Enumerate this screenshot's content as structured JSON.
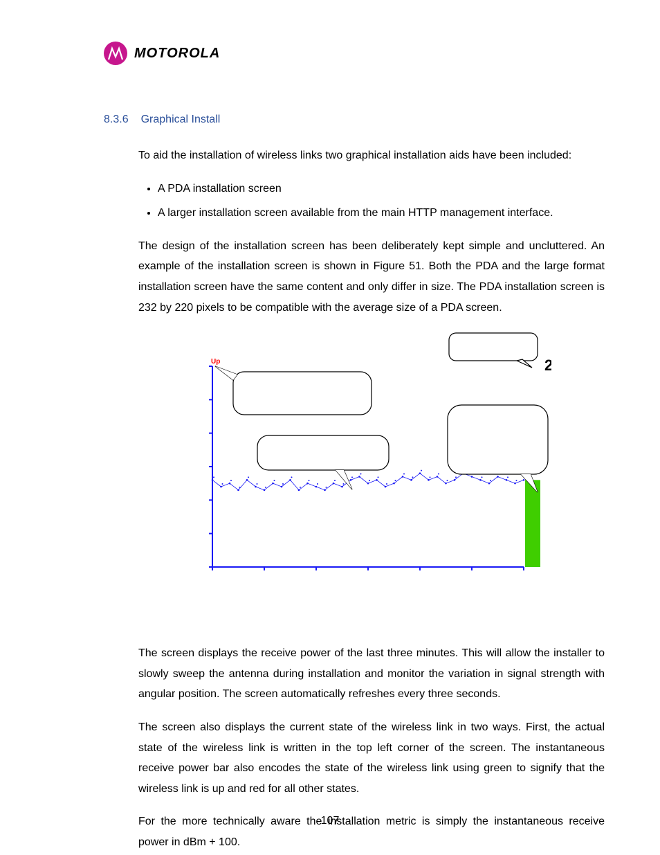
{
  "brand": "MOTOROLA",
  "section": {
    "number": "8.3.6",
    "title": "Graphical Install"
  },
  "para1": "To aid the installation of wireless links two graphical installation aids have been included:",
  "bullets": [
    "A PDA installation screen",
    "A larger installation screen available from the main HTTP management interface."
  ],
  "para2": "The design of the installation screen has been deliberately kept simple and uncluttered. An example of the installation screen is shown in Figure 51. Both the PDA and the large format installation screen have the same content and only differ in size. The PDA installation screen is 232 by 220 pixels to be compatible with the average size of a PDA screen.",
  "para3": "The screen displays the receive power of the last three minutes. This will allow the installer to slowly sweep the antenna during installation and monitor the variation in signal strength with angular position. The screen automatically refreshes every three seconds.",
  "para4": "The screen also displays the current state of the wireless link in two ways. First, the actual state of the wireless link is written in the top left corner of the screen. The instantaneous receive power bar also encodes the state of the wireless link using green to signify that the wireless link is up and red for all other states.",
  "para5": "For the more technically aware the installation metric is simply the instantaneous receive power in dBm + 100.",
  "pageNumber": "107",
  "chart_data": {
    "type": "line",
    "title": "",
    "xlabel": "",
    "ylabel": "",
    "ylim": [
      0,
      60
    ],
    "up_label": "Up",
    "metric_value": 26,
    "bar_color": "#3fce00",
    "line_color": "#1a1af5",
    "y_ticks": [
      0,
      10,
      20,
      30,
      40,
      50,
      60
    ],
    "x": [
      0,
      5,
      10,
      15,
      20,
      25,
      30,
      35,
      40,
      45,
      50,
      55,
      60,
      65,
      70,
      75,
      80,
      85,
      90,
      95,
      100,
      105,
      110,
      115,
      120,
      125,
      130,
      135,
      140,
      145,
      150,
      155,
      160,
      165,
      170,
      175,
      180
    ],
    "values": [
      26,
      24,
      25,
      23,
      26,
      24,
      23,
      25,
      24,
      26,
      23,
      25,
      24,
      23,
      25,
      24,
      26,
      27,
      25,
      26,
      24,
      25,
      27,
      26,
      28,
      26,
      27,
      25,
      26,
      28,
      27,
      26,
      25,
      27,
      26,
      25,
      26
    ]
  }
}
